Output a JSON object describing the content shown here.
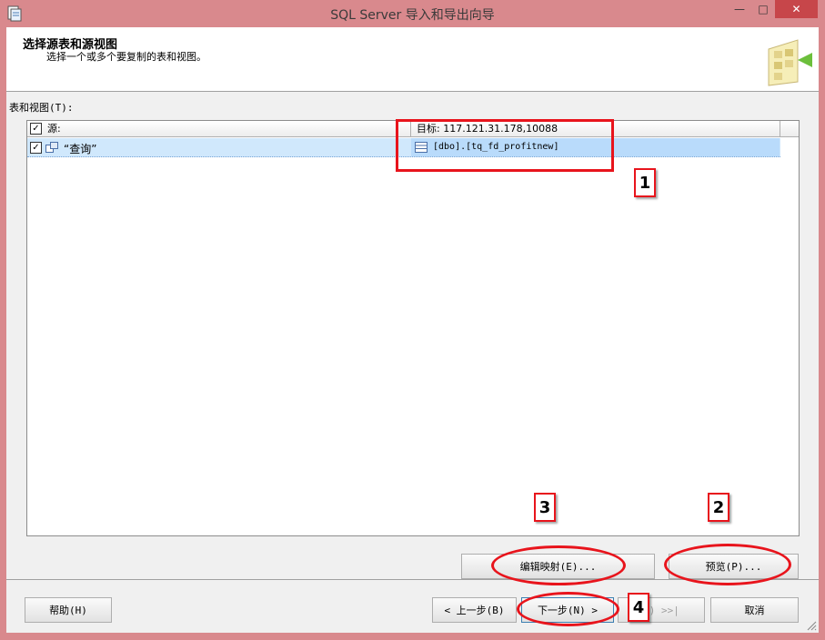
{
  "window": {
    "title": "SQL Server 导入和导出向导",
    "min_glyph": "—",
    "max_glyph": "□",
    "close_glyph": "✕"
  },
  "header": {
    "title": "选择源表和源视图",
    "subtitle": "选择一个或多个要复制的表和视图。"
  },
  "tables_label": "表和视图(T):",
  "grid": {
    "columns": {
      "source": "源:",
      "target": "目标: 117.121.31.178,10088"
    },
    "rows": [
      {
        "checked": true,
        "source": "“查询”",
        "target": "[dbo].[tq_fd_profitnew]"
      }
    ]
  },
  "buttons": {
    "edit_mappings": "编辑映射(E)...",
    "preview": "预览(P)...",
    "help": "帮助(H)",
    "back": "< 上一步(B)",
    "next": "下一步(N) >",
    "finish": "F) >>|",
    "cancel": "取消"
  },
  "annotations": [
    "1",
    "2",
    "3",
    "4"
  ],
  "colors": {
    "window_frame": "#d9898d",
    "close_button": "#c7464a",
    "selection": "#b9dbfb",
    "annotation": "#e8141c"
  }
}
